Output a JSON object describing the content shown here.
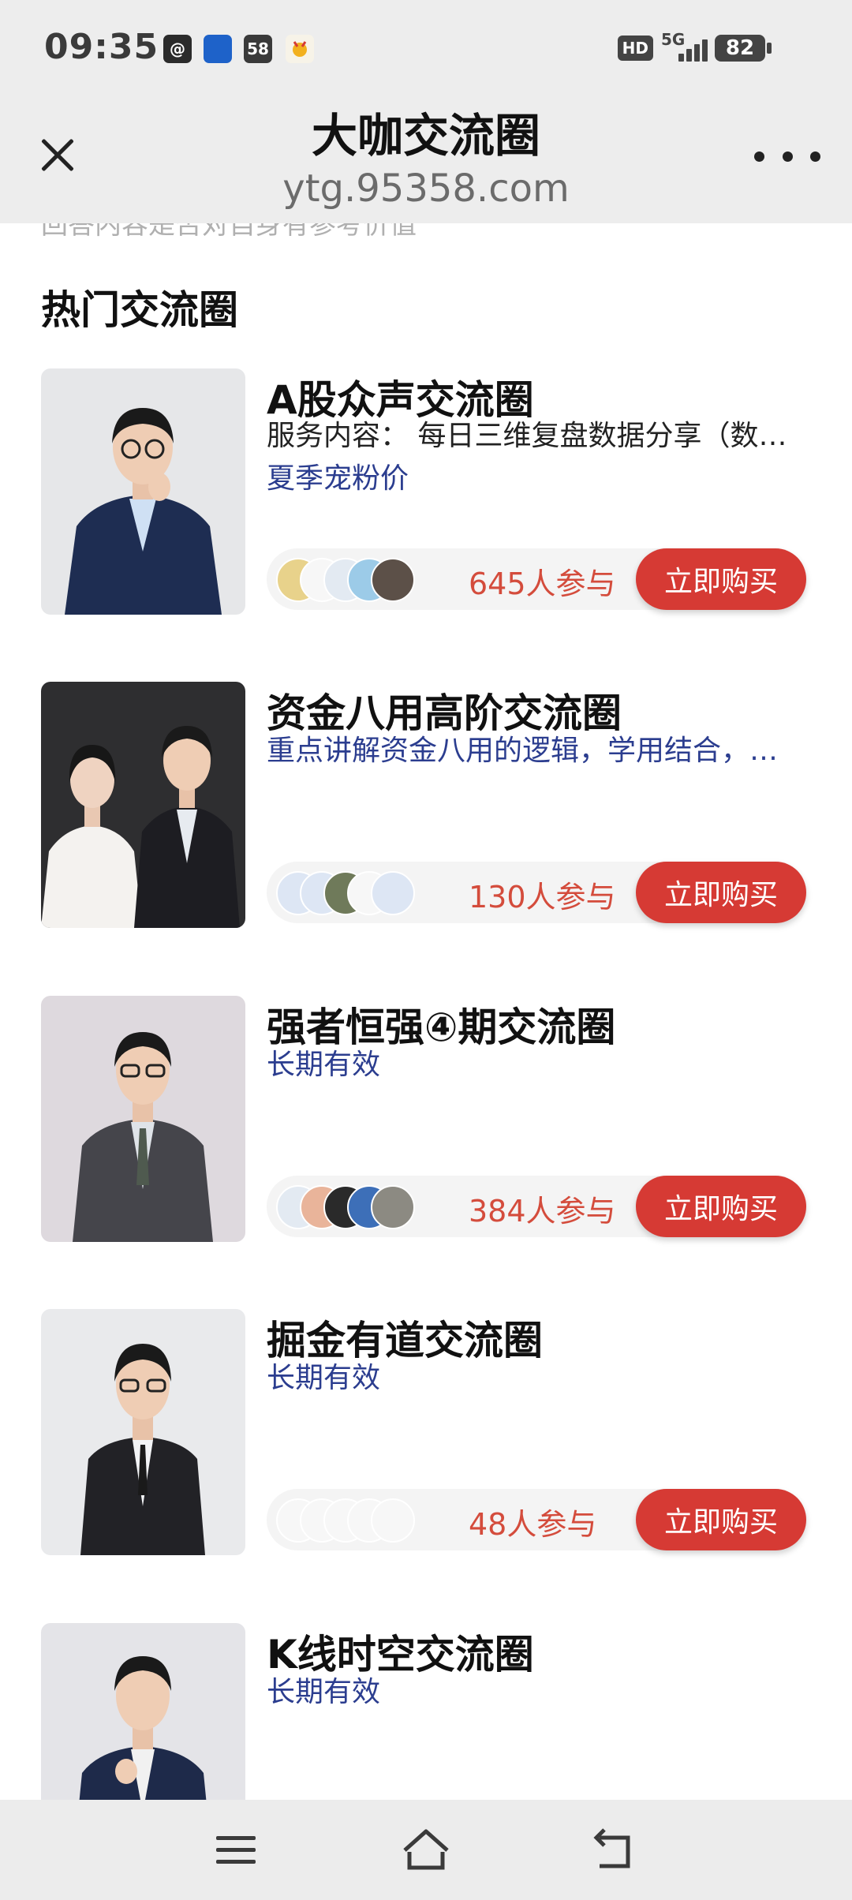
{
  "status_bar": {
    "time": "09:35",
    "apps": [
      {
        "icon": "at-app-icon",
        "text": "@",
        "color": "#2b2b2b"
      },
      {
        "icon": "blue-banner-app-icon",
        "text": "",
        "color": "#1e62c9"
      },
      {
        "icon": "app-58-icon",
        "text": "58",
        "color": "#3a3a3a"
      },
      {
        "icon": "deer-app-icon",
        "text": "",
        "color": "#f2b01e"
      }
    ],
    "hd": "HD",
    "network": "5G",
    "battery": "82"
  },
  "header": {
    "title": "大咖交流圈",
    "url": "ytg.95358.com"
  },
  "content": {
    "cut_text": "回答内容是否对自身有参考价值",
    "section_title": "热门交流圈",
    "buy_label": "立即购买",
    "cards": [
      {
        "title": "A股众声交流圈",
        "desc": "服务内容： 每日三维复盘数据分享（数据分享及解读）",
        "tag": "夏季宠粉价",
        "count": "645人参与"
      },
      {
        "title": "资金八用高阶交流圈",
        "desc": "",
        "tag": "重点讲解资金八用的逻辑，学用结合，实战应用",
        "count": "130人参与"
      },
      {
        "title": "强者恒强④期交流圈",
        "desc": "",
        "tag": "长期有效",
        "count": "384人参与"
      },
      {
        "title": "掘金有道交流圈",
        "desc": "",
        "tag": "长期有效",
        "count": "48人参与"
      },
      {
        "title": "K线时空交流圈",
        "desc": "",
        "tag": "长期有效",
        "count": ""
      }
    ]
  },
  "colors": {
    "accent_red": "#d63a34",
    "count_red": "#d44c3c",
    "tag_blue": "#2b3d8f"
  }
}
